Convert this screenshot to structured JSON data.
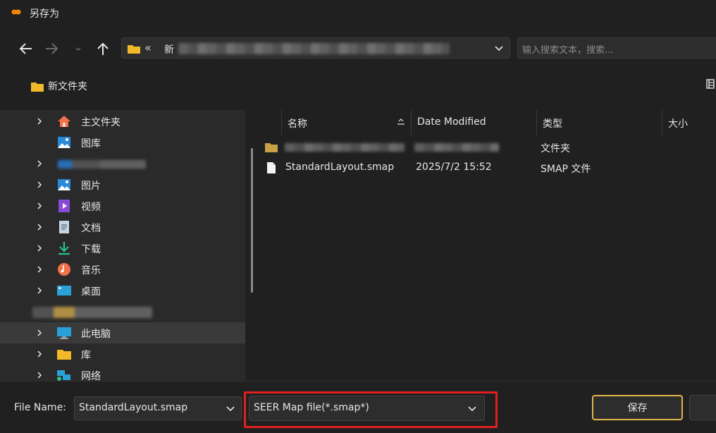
{
  "window": {
    "title": "另存为"
  },
  "search": {
    "placeholder": "输入搜索文本，搜索..."
  },
  "address": {
    "crumb": "新"
  },
  "toolbar": {
    "new_folder_label": "新文件夹"
  },
  "sidebar": {
    "items": [
      {
        "label": "主文件夹",
        "icon": "home-icon",
        "expandable": true
      },
      {
        "label": "图库",
        "icon": "gallery-icon",
        "expandable": false
      },
      {
        "label": "",
        "icon": "cloud-icon",
        "expandable": true
      },
      {
        "label": "图片",
        "icon": "pictures-icon",
        "expandable": true
      },
      {
        "label": "视频",
        "icon": "videos-icon",
        "expandable": true
      },
      {
        "label": "文档",
        "icon": "documents-icon",
        "expandable": true
      },
      {
        "label": "下载",
        "icon": "downloads-icon",
        "expandable": true
      },
      {
        "label": "音乐",
        "icon": "music-icon",
        "expandable": true
      },
      {
        "label": "桌面",
        "icon": "desktop-icon",
        "expandable": true
      },
      {
        "label": "",
        "icon": "folder-icon",
        "expandable": false
      },
      {
        "label": "此电脑",
        "icon": "this-pc-icon",
        "expandable": true,
        "selected": true
      },
      {
        "label": "库",
        "icon": "library-icon",
        "expandable": true
      },
      {
        "label": "网络",
        "icon": "network-icon",
        "expandable": true
      }
    ]
  },
  "columns": {
    "name": "名称",
    "date": "Date Modified",
    "type": "类型",
    "size": "大小"
  },
  "files": [
    {
      "name": "",
      "date": "",
      "type": "文件夹",
      "icon": "folder-icon"
    },
    {
      "name": "StandardLayout.smap",
      "date": "2025/7/2 15:52",
      "type": "SMAP 文件",
      "icon": "file-icon"
    }
  ],
  "bottom": {
    "file_name_label": "File Name:",
    "file_name_value": "StandardLayout.smap",
    "file_type_value": "SEER Map file(*.smap*)",
    "save_label": "保存"
  },
  "colors": {
    "accent": "#e0b84a",
    "highlight": "#e02020",
    "folder": "#f2b928"
  }
}
